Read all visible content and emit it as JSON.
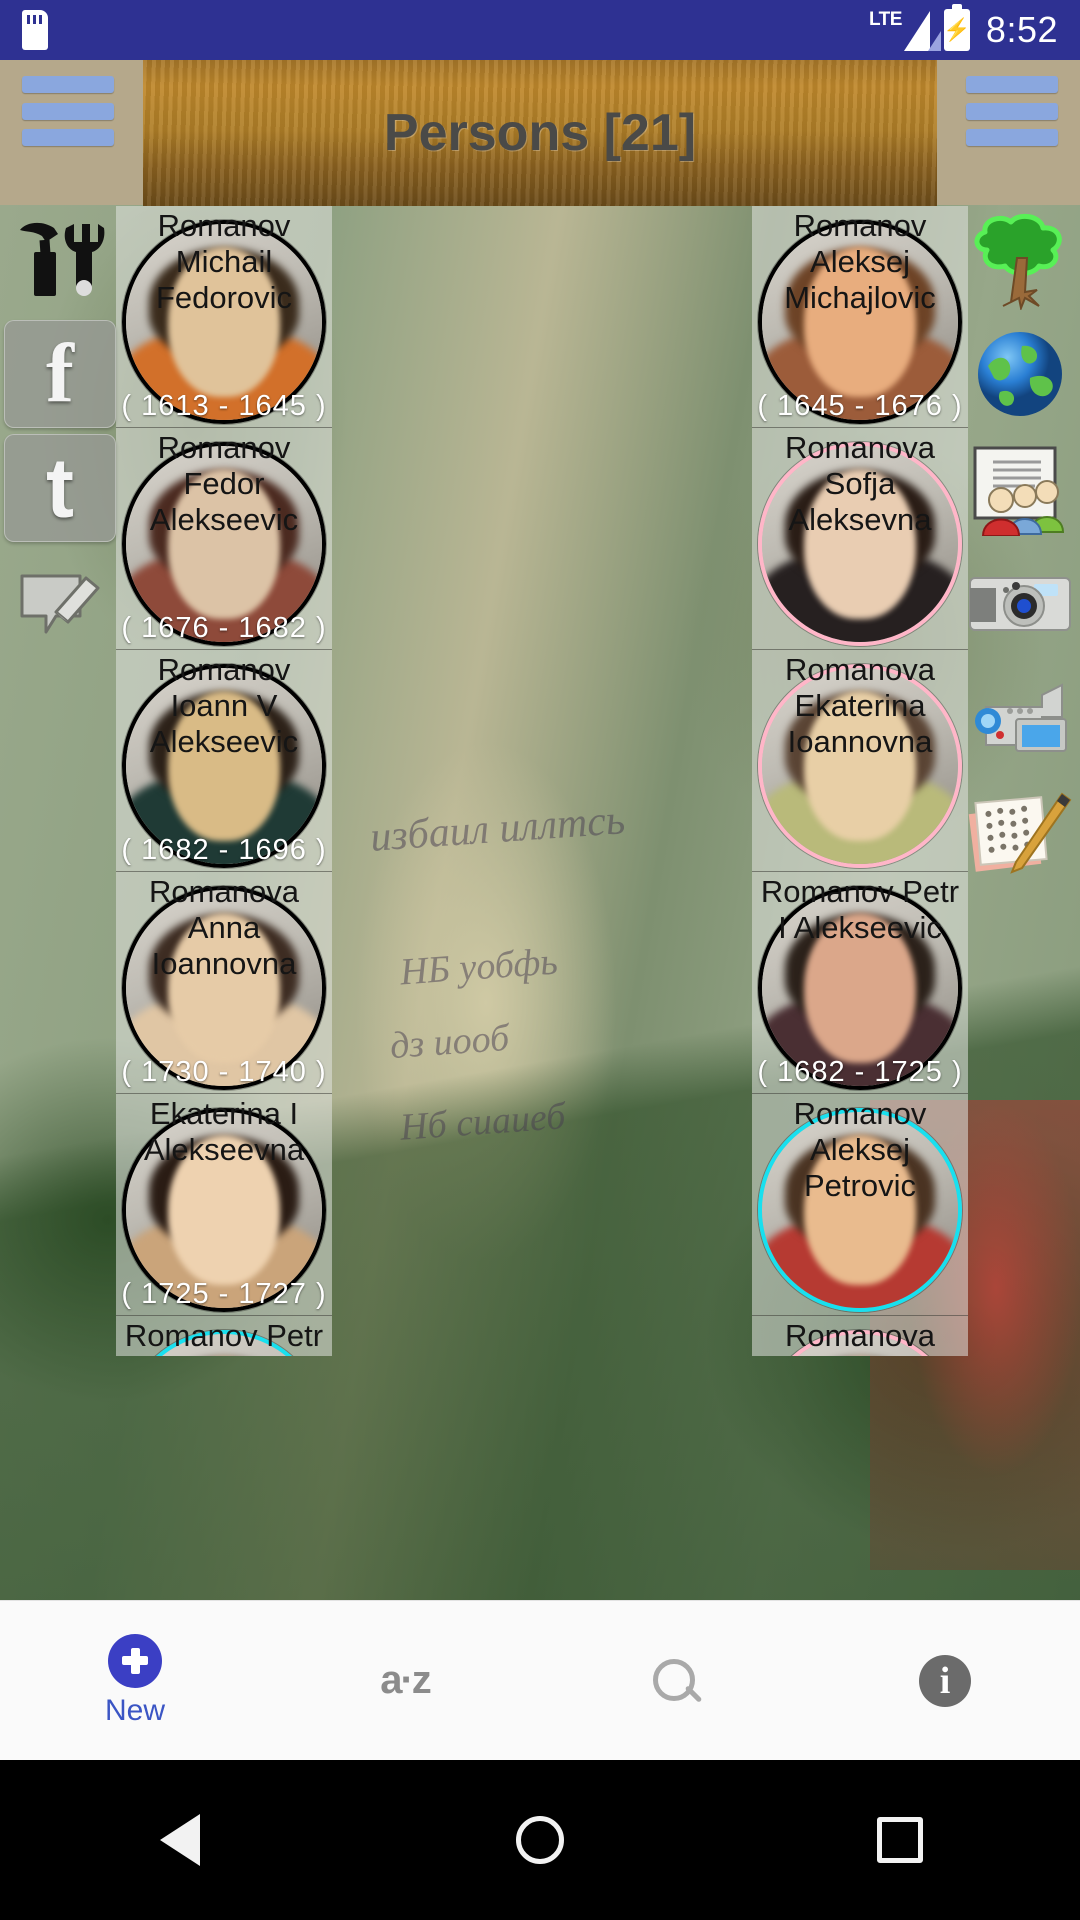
{
  "statusbar": {
    "sd_icon": "sd-card-icon",
    "network_label": "LTE",
    "signal_icon": "signal-bars-icon",
    "battery_icon": "battery-charging-icon",
    "time": "8:52"
  },
  "titlebar": {
    "title": "Persons [21]",
    "menu_left_icon": "hamburger-menu-icon",
    "menu_right_icon": "hamburger-menu-icon"
  },
  "sidebar_left": {
    "items": [
      {
        "name": "tools-icon",
        "glyph": "⚒",
        "label": "Tools",
        "plate": false
      },
      {
        "name": "facebook-icon",
        "glyph": "f",
        "label": "Facebook",
        "plate": true
      },
      {
        "name": "twitter-icon",
        "glyph": "t",
        "label": "Twitter",
        "plate": true
      },
      {
        "name": "feedback-icon",
        "glyph": "✍",
        "label": "Feedback",
        "plate": false
      }
    ]
  },
  "sidebar_right": {
    "items": [
      {
        "name": "family-tree-icon",
        "label": "Tree"
      },
      {
        "name": "globe-icon",
        "label": "Places"
      },
      {
        "name": "persons-icon",
        "label": "Persons"
      },
      {
        "name": "camera-icon",
        "label": "Photos"
      },
      {
        "name": "camcorder-icon",
        "label": "Videos"
      },
      {
        "name": "documents-icon",
        "label": "Documents"
      }
    ]
  },
  "background": {
    "scribbles": [
      "избаил иллтсь",
      "НБ уобфь",
      "дз иооб",
      "Нб сиаиеб"
    ]
  },
  "persons": [
    {
      "name": "Romanov Michail Fedorovic",
      "dates": "( 1613 - 1645 )",
      "ring": "ring-black",
      "hair": "#3a2b1c",
      "face": "#e0c39a",
      "robe": "#d2702a"
    },
    {
      "name": "Romanov Aleksej Michajlovic",
      "dates": "( 1645 - 1676 )",
      "ring": "ring-black",
      "hair": "#6d4326",
      "face": "#e8ad7e",
      "robe": "#9c5c3a"
    },
    {
      "name": "Romanov Fedor Alekseevic",
      "dates": "( 1676 - 1682 )",
      "ring": "ring-black",
      "hair": "#4b2a20",
      "face": "#dcc3a6",
      "robe": "#8e4a3a"
    },
    {
      "name": "Romanova Sofja Aleksevna",
      "dates": "",
      "ring": "ring-pink",
      "hair": "#2a1d16",
      "face": "#e9cdb2",
      "robe": "#262020"
    },
    {
      "name": "Romanov Ioann V Alekseevic",
      "dates": "( 1682 - 1696 )",
      "ring": "ring-black",
      "hair": "#2c2118",
      "face": "#d9bb86",
      "robe": "#1f3a35"
    },
    {
      "name": "Romanova Ekaterina Ioannovna",
      "dates": "",
      "ring": "ring-pink",
      "hair": "#5a4434",
      "face": "#e8cfa6",
      "robe": "#b9ba7a"
    },
    {
      "name": "Romanova Anna Ioannovna",
      "dates": "( 1730 - 1740 )",
      "ring": "ring-black",
      "hair": "#3d2c22",
      "face": "#e6cba7",
      "robe": "#e0c6a4"
    },
    {
      "name": "Romanov Petr I Alekseevic",
      "dates": "( 1682 - 1725 )",
      "ring": "ring-black",
      "hair": "#2b211a",
      "face": "#dba78a",
      "robe": "#4a2f33"
    },
    {
      "name": "Ekaterina I Alekseevna",
      "dates": "( 1725 - 1727 )",
      "ring": "ring-black",
      "hair": "#2a1c14",
      "face": "#eed2b0",
      "robe": "#caa47a"
    },
    {
      "name": "Romanov Aleksej Petrovic",
      "dates": "",
      "ring": "ring-cyan",
      "hair": "#4a3322",
      "face": "#e9bb8e",
      "robe": "#b63a32"
    },
    {
      "name": "Romanov Petr II Alekseevic",
      "dates": "",
      "ring": "ring-cyan",
      "hair": "#3a2a1e",
      "face": "#e4c59c",
      "robe": "#6b4a3a"
    },
    {
      "name": "Romanova Anna Petrovna",
      "dates": "",
      "ring": "ring-pink",
      "hair": "#3a2a20",
      "face": "#eccfae",
      "robe": "#8e6a8a"
    }
  ],
  "bottombar": {
    "items": [
      {
        "name": "new-button",
        "icon": "plus-circle-icon",
        "label": "New"
      },
      {
        "name": "sort-button",
        "icon": "a-z-sort-icon",
        "label": "a·z"
      },
      {
        "name": "search-button",
        "icon": "magnifier-icon",
        "label": ""
      },
      {
        "name": "info-button",
        "icon": "info-icon",
        "label": ""
      }
    ]
  },
  "navbar": {
    "back": "back-triangle-icon",
    "home": "home-circle-icon",
    "recent": "recent-square-icon"
  },
  "colors": {
    "statusbar": "#2e3192",
    "accent": "#3b3fc4",
    "banner": "#b07f28",
    "ring_pink": "#ffb6c8",
    "ring_cyan": "#18e0ef"
  }
}
